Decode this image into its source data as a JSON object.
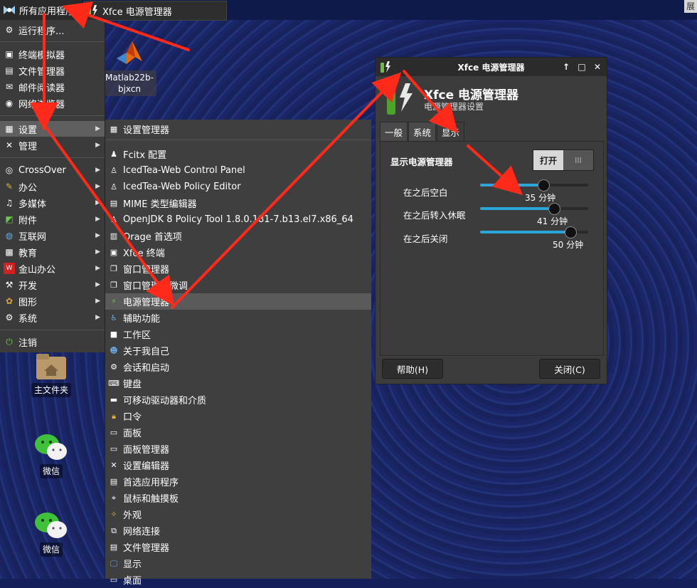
{
  "panel": {
    "apps_label": "所有应用程序",
    "task_label": "Xfce 电源管理器",
    "right_label": "展"
  },
  "desktop": {
    "icons": [
      {
        "label_line1": "Matlab22b-",
        "label_line2": "bjxcn",
        "icon": "matlab-icon"
      },
      {
        "label": "主文件夹",
        "icon": "home-folder-icon"
      },
      {
        "label": "微信",
        "icon": "wechat-icon"
      },
      {
        "label": "微信",
        "icon": "wechat-icon"
      }
    ]
  },
  "menu": {
    "items": [
      {
        "label": "运行程序...",
        "icon": "run-icon"
      },
      {
        "label": "终端模拟器",
        "icon": "terminal-icon"
      },
      {
        "label": "文件管理器",
        "icon": "file-manager-icon"
      },
      {
        "label": "邮件阅读器",
        "icon": "mail-icon"
      },
      {
        "label": "网络浏览器",
        "icon": "web-browser-icon"
      },
      {
        "label": "设置",
        "icon": "settings-icon"
      },
      {
        "label": "管理",
        "icon": "admin-icon"
      },
      {
        "label": "CrossOver",
        "icon": "crossover-icon"
      },
      {
        "label": "办公",
        "icon": "office-icon"
      },
      {
        "label": "多媒体",
        "icon": "multimedia-icon"
      },
      {
        "label": "附件",
        "icon": "accessories-icon"
      },
      {
        "label": "互联网",
        "icon": "internet-icon"
      },
      {
        "label": "教育",
        "icon": "education-icon"
      },
      {
        "label": "金山办公",
        "icon": "wps-icon"
      },
      {
        "label": "开发",
        "icon": "development-icon"
      },
      {
        "label": "图形",
        "icon": "graphics-icon"
      },
      {
        "label": "系统",
        "icon": "system-icon"
      },
      {
        "label": "注销",
        "icon": "logout-icon"
      }
    ]
  },
  "submenu": {
    "items": [
      {
        "label": "设置管理器"
      },
      {
        "label": "Fcitx 配置"
      },
      {
        "label": "IcedTea-Web Control Panel"
      },
      {
        "label": "IcedTea-Web Policy Editor"
      },
      {
        "label": "MIME 类型编辑器"
      },
      {
        "label": "OpenJDK 8 Policy Tool 1.8.0.181-7.b13.el7.x86_64"
      },
      {
        "label": "Orage 首选项"
      },
      {
        "label": "Xfce 终端"
      },
      {
        "label": "窗口管理器"
      },
      {
        "label": "窗口管理器微调"
      },
      {
        "label": "电源管理器"
      },
      {
        "label": "辅助功能"
      },
      {
        "label": "工作区"
      },
      {
        "label": "关于我自己"
      },
      {
        "label": "会话和启动"
      },
      {
        "label": "键盘"
      },
      {
        "label": "可移动驱动器和介质"
      },
      {
        "label": "口令"
      },
      {
        "label": "面板"
      },
      {
        "label": "面板管理器"
      },
      {
        "label": "设置编辑器"
      },
      {
        "label": "首选应用程序"
      },
      {
        "label": "鼠标和触摸板"
      },
      {
        "label": "外观"
      },
      {
        "label": "网络连接"
      },
      {
        "label": "文件管理器"
      },
      {
        "label": "显示"
      },
      {
        "label": "桌面"
      }
    ]
  },
  "dialog": {
    "window_title": "Xfce 电源管理器",
    "header_title": "Xfce 电源管理器",
    "header_subtitle": "电源管理器设置",
    "tabs": [
      "一般",
      "系统",
      "显示"
    ],
    "display_toggle_label": "显示电源管理器",
    "toggle_on": "打开",
    "toggle_off": "III",
    "rows": [
      {
        "label": "在之后空白",
        "value": 35,
        "value_text": "35 分钟"
      },
      {
        "label": "在之后转入休眠",
        "value": 41,
        "value_text": "41 分钟"
      },
      {
        "label": "在之后关闭",
        "value": 50,
        "value_text": "50 分钟"
      }
    ],
    "help_button": "帮助(H)",
    "close_button": "关闭(C)"
  },
  "colors": {
    "accent": "#2aa7d8",
    "annotation_arrow": "#ff2a1a"
  }
}
